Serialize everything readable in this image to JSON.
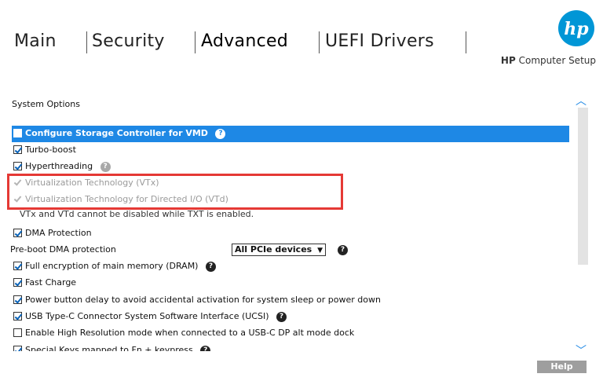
{
  "tabs": [
    "Main",
    "Security",
    "Advanced",
    "UEFI Drivers"
  ],
  "brand": {
    "bold": "HP",
    "rest": "Computer Setup"
  },
  "logo_text": "hp",
  "section_title": "System Options",
  "options": [
    {
      "label": "Configure Storage Controller for VMD",
      "checked": false,
      "help": true
    },
    {
      "label": "Turbo-boost",
      "checked": true,
      "help": false
    },
    {
      "label": "Hyperthreading",
      "checked": true,
      "help": true
    },
    {
      "label": "Virtualization Technology (VTx)",
      "checked": true,
      "disabled": true
    },
    {
      "label": "Virtualization Technology for Directed I/O (VTd)",
      "checked": true,
      "disabled": true
    }
  ],
  "note": "VTx and VTd cannot be disabled while TXT is enabled.",
  "dma_protection": {
    "label": "DMA Protection",
    "checked": true
  },
  "preboot_dma": {
    "label": "Pre-boot DMA protection",
    "value": "All PCIe devices"
  },
  "options2": [
    {
      "label": "Full encryption of main memory (DRAM)",
      "checked": true,
      "help": true
    },
    {
      "label": "Fast Charge",
      "checked": true,
      "help": false
    },
    {
      "label": "Power button delay to avoid accidental activation for system sleep or power down",
      "checked": true,
      "help": false
    },
    {
      "label": "USB Type-C Connector System Software Interface (UCSI)",
      "checked": true,
      "help": true
    },
    {
      "label": "Enable High Resolution mode when connected to a USB-C DP alt mode dock",
      "checked": false,
      "help": false
    },
    {
      "label": "Special Keys mapped to Fn + keypress",
      "checked": true,
      "help": true
    }
  ],
  "help_button": "Help",
  "icons": {
    "help": "question-circle-icon",
    "up": "chevron-up-icon",
    "down": "chevron-down-icon"
  },
  "colors": {
    "accent": "#1e88e5",
    "redbox": "#e53935",
    "logo": "#0096d6"
  }
}
